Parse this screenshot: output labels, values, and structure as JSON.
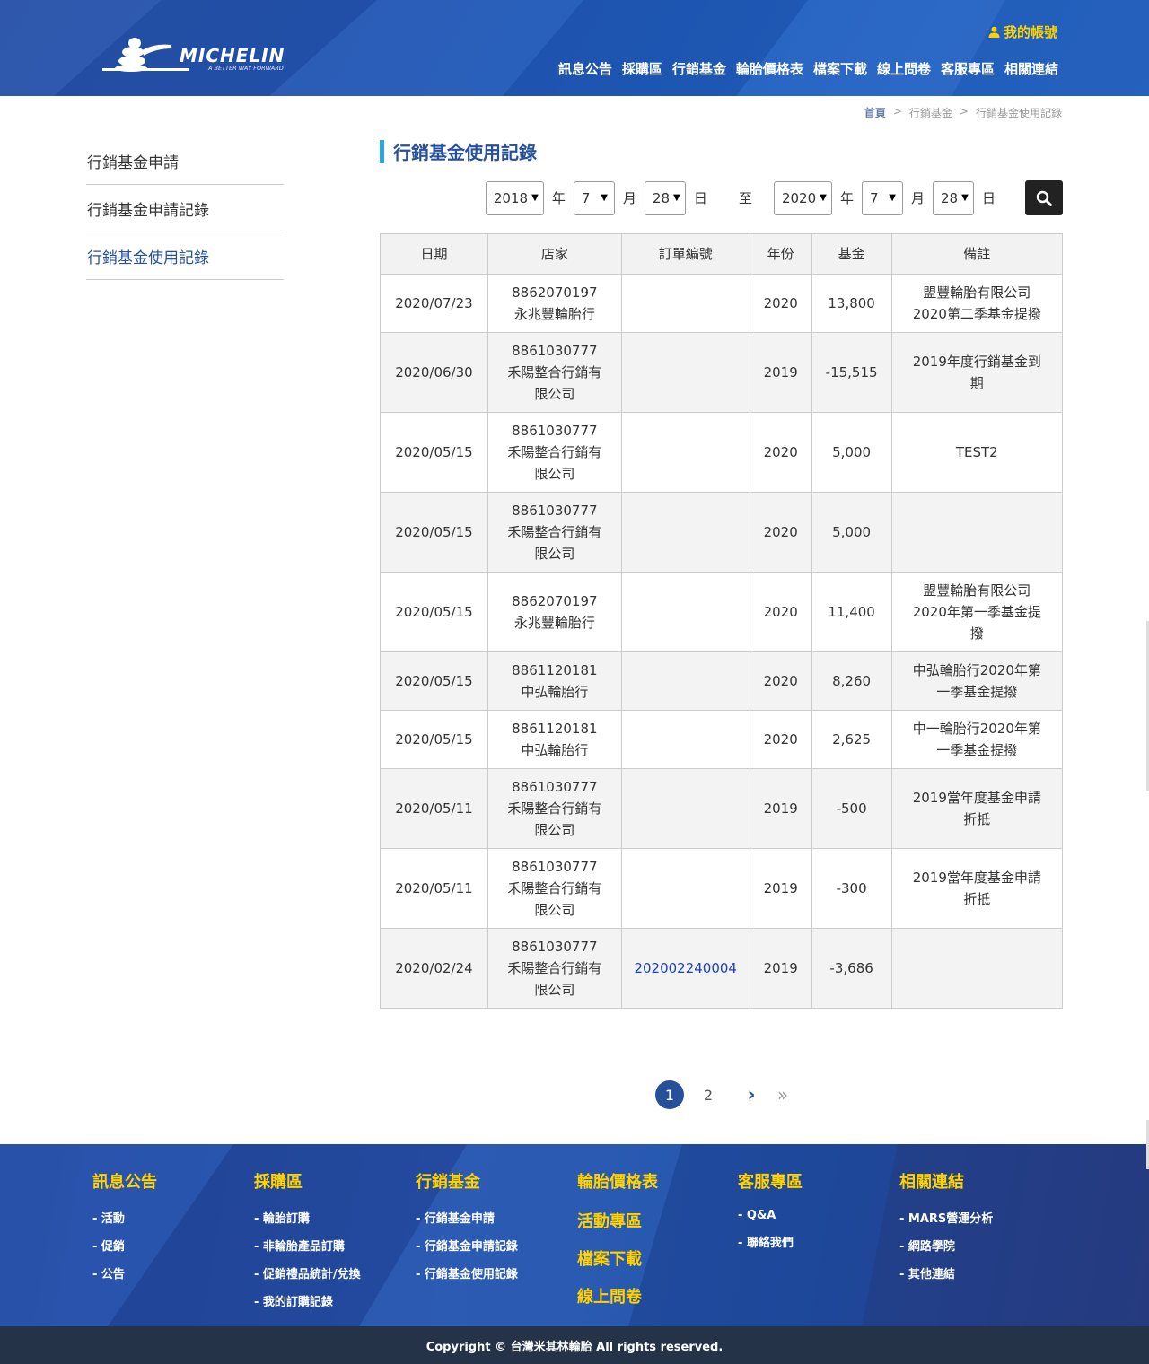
{
  "header": {
    "brand": "MICHELIN",
    "tagline": "A BETTER WAY FORWARD",
    "account_label": "我的帳號",
    "nav": [
      "訊息公告",
      "採購區",
      "行銷基金",
      "輪胎價格表",
      "檔案下載",
      "線上問卷",
      "客服專區",
      "相關連結"
    ]
  },
  "breadcrumb": [
    "首頁",
    "行銷基金",
    "行銷基金使用記錄"
  ],
  "breadcrumb_sep": ">",
  "sidebar": {
    "items": [
      {
        "label": "行銷基金申請"
      },
      {
        "label": "行銷基金申請記錄"
      },
      {
        "label": "行銷基金使用記錄"
      }
    ]
  },
  "main": {
    "title": "行銷基金使用記錄",
    "filter": {
      "from": {
        "year": "2018",
        "month": "7",
        "day": "28"
      },
      "to": {
        "year": "2020",
        "month": "7",
        "day": "28"
      },
      "year_label": "年",
      "month_label": "月",
      "day_label": "日",
      "to_label": "至"
    },
    "table": {
      "headers": [
        "日期",
        "店家",
        "訂單編號",
        "年份",
        "基金",
        "備註"
      ],
      "rows": [
        {
          "date": "2020/07/23",
          "shop": "8862070197\n永兆豐輪胎行",
          "order": "",
          "year": "2020",
          "fund": "13,800",
          "note": "盟豐輪胎有限公司\n2020第二季基金提撥"
        },
        {
          "date": "2020/06/30",
          "shop": "8861030777\n禾陽整合行銷有\n限公司",
          "order": "",
          "year": "2019",
          "fund": "-15,515",
          "note": "2019年度行銷基金到\n期"
        },
        {
          "date": "2020/05/15",
          "shop": "8861030777\n禾陽整合行銷有\n限公司",
          "order": "",
          "year": "2020",
          "fund": "5,000",
          "note": "TEST2"
        },
        {
          "date": "2020/05/15",
          "shop": "8861030777\n禾陽整合行銷有\n限公司",
          "order": "",
          "year": "2020",
          "fund": "5,000",
          "note": ""
        },
        {
          "date": "2020/05/15",
          "shop": "8862070197\n永兆豐輪胎行",
          "order": "",
          "year": "2020",
          "fund": "11,400",
          "note": "盟豐輪胎有限公司\n2020年第一季基金提\n撥"
        },
        {
          "date": "2020/05/15",
          "shop": "8861120181\n中弘輪胎行",
          "order": "",
          "year": "2020",
          "fund": "8,260",
          "note": "中弘輪胎行2020年第\n一季基金提撥"
        },
        {
          "date": "2020/05/15",
          "shop": "8861120181\n中弘輪胎行",
          "order": "",
          "year": "2020",
          "fund": "2,625",
          "note": "中一輪胎行2020年第\n一季基金提撥"
        },
        {
          "date": "2020/05/11",
          "shop": "8861030777\n禾陽整合行銷有\n限公司",
          "order": "",
          "year": "2019",
          "fund": "-500",
          "note": "2019當年度基金申請\n折抵"
        },
        {
          "date": "2020/05/11",
          "shop": "8861030777\n禾陽整合行銷有\n限公司",
          "order": "",
          "year": "2019",
          "fund": "-300",
          "note": "2019當年度基金申請\n折抵"
        },
        {
          "date": "2020/02/24",
          "shop": "8861030777\n禾陽整合行銷有\n限公司",
          "order": "202002240004",
          "year": "2019",
          "fund": "-3,686",
          "note": ""
        }
      ]
    },
    "pagination": {
      "pages": [
        "1",
        "2"
      ],
      "current": "1",
      "next": "›",
      "last": "»"
    }
  },
  "footer": {
    "columns": [
      {
        "heading": "訊息公告",
        "links": [
          "- 活動",
          "- 促銷",
          "- 公告"
        ]
      },
      {
        "heading": "採購區",
        "links": [
          "- 輪胎訂購",
          "- 非輪胎產品訂購",
          "- 促銷禮品統計/兌換",
          "- 我的訂購記錄"
        ]
      },
      {
        "heading": "行銷基金",
        "links": [
          "- 行銷基金申請",
          "- 行銷基金申請記錄",
          "- 行銷基金使用記錄"
        ]
      },
      {
        "heading": "輪胎價格表",
        "extra_headings": [
          "活動專區",
          "檔案下載",
          "線上問卷"
        ],
        "links": []
      },
      {
        "heading": "客服專區",
        "links": [
          "- Q&A",
          "- 聯絡我們"
        ]
      },
      {
        "heading": "相關連結",
        "links": [
          "- MARS營運分析",
          "- 網路學院",
          "- 其他連結"
        ]
      }
    ],
    "copyright": "Copyright © 台灣米其林輪胎 All rights reserved."
  },
  "colors": {
    "brand_blue": "#27509b",
    "accent_yellow": "#ffd200",
    "title_bar": "#29a8e0",
    "link_blue": "#1a3fc7"
  }
}
